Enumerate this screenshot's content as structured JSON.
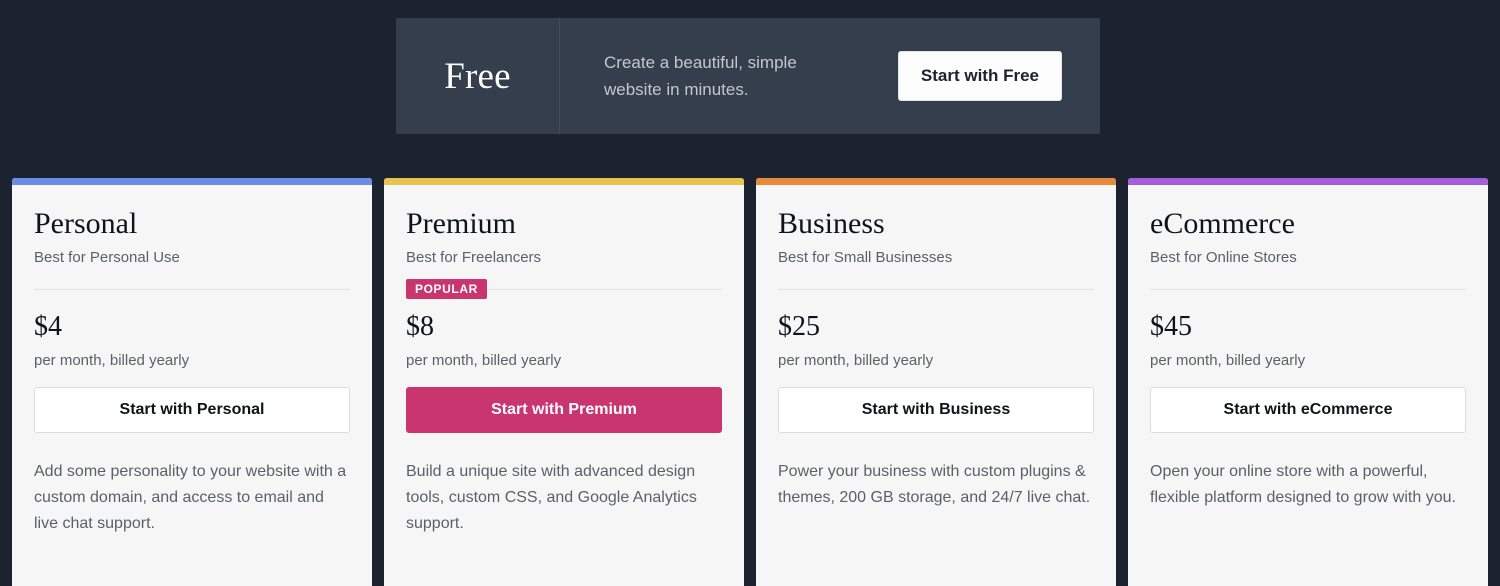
{
  "free_banner": {
    "title": "Free",
    "description": "Create a beautiful, simple website in minutes.",
    "cta_label": "Start with Free"
  },
  "plans": [
    {
      "name": "Personal",
      "tagline": "Best for Personal Use",
      "badge": "",
      "price": "$4",
      "billing": "per month, billed yearly",
      "cta_label": "Start with Personal",
      "description": "Add some personality to your website with a custom domain, and access to email and live chat support.",
      "accent_color": "#6a8ce8",
      "cta_style": "outline"
    },
    {
      "name": "Premium",
      "tagline": "Best for Freelancers",
      "badge": "POPULAR",
      "price": "$8",
      "billing": "per month, billed yearly",
      "cta_label": "Start with Premium",
      "description": "Build a unique site with advanced design tools, custom CSS, and Google Analytics support.",
      "accent_color": "#e8c24f",
      "cta_style": "primary"
    },
    {
      "name": "Business",
      "tagline": "Best for Small Businesses",
      "badge": "",
      "price": "$25",
      "billing": "per month, billed yearly",
      "cta_label": "Start with Business",
      "description": "Power your business with custom plugins & themes, 200 GB storage, and 24/7 live chat.",
      "accent_color": "#e8893c",
      "cta_style": "outline"
    },
    {
      "name": "eCommerce",
      "tagline": "Best for Online Stores",
      "badge": "",
      "price": "$45",
      "billing": "per month, billed yearly",
      "cta_label": "Start with eCommerce",
      "description": "Open your online store with a powerful, flexible platform designed to grow with you.",
      "accent_color": "#a45ddb",
      "cta_style": "outline"
    }
  ],
  "theme": {
    "background": "#1b2230",
    "banner_background": "#343e4d",
    "card_background": "#f6f6f6",
    "badge_color": "#c9356e",
    "primary_cta_color": "#c9356e"
  }
}
